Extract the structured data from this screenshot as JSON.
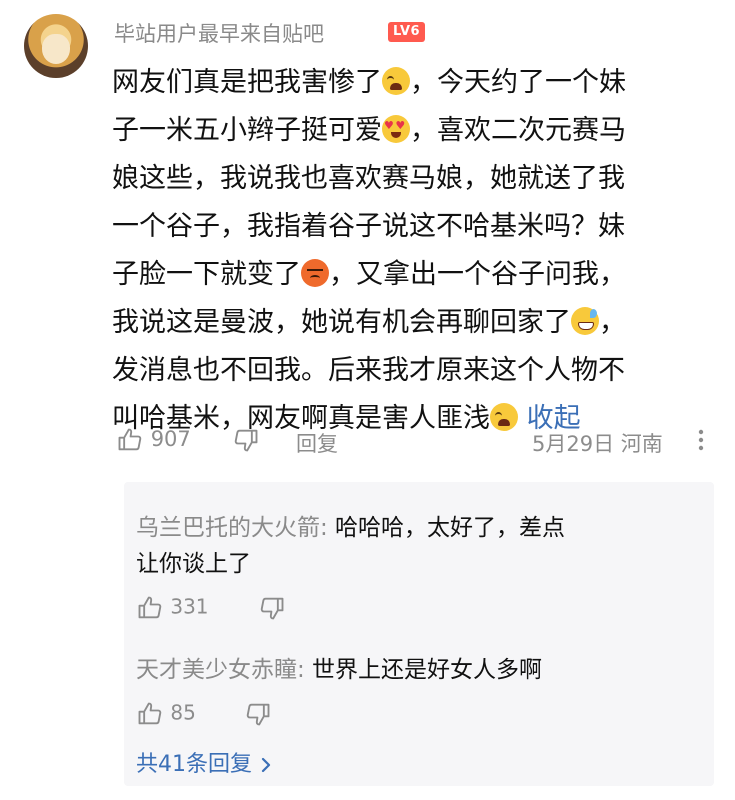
{
  "comment": {
    "username": "毕站用户最早来自贴吧",
    "level_badge": "LV6",
    "lines": [
      {
        "text": "网友们真是把我害惨了",
        "emoji": "crying-face",
        "tail": "，今天约了一个妹"
      },
      {
        "text": "子一米五小辫子挺可爱",
        "emoji": "heart-eyes-face",
        "tail": "，喜欢二次元赛马"
      },
      {
        "text": "娘这些，我说我也喜欢赛马娘，她就送了我",
        "emoji": "",
        "tail": ""
      },
      {
        "text": "一个谷子，我指着谷子说这不哈基米吗？妹",
        "emoji": "",
        "tail": ""
      },
      {
        "text": "子脸一下就变了",
        "emoji": "angry-face",
        "tail": "，又拿出一个谷子问我，"
      },
      {
        "text": "我说这是曼波，她说有机会再聊回家了",
        "emoji": "sweat-smile-face",
        "tail": "，"
      },
      {
        "text": "发消息也不回我。后来我才原来这个人物不",
        "emoji": "",
        "tail": ""
      },
      {
        "text": "叫哈基米，网友啊真是害人匪浅",
        "emoji": "crying-face",
        "tail": ""
      }
    ],
    "collapse_label": "收起",
    "like_count": "907",
    "reply_label": "回复",
    "date": "5月29日",
    "location": "河南"
  },
  "replies": [
    {
      "name": "乌兰巴托的大火箭:",
      "text_line1": " 哈哈哈，太好了，差点",
      "text_line2": "让你谈上了",
      "like_count": "331"
    },
    {
      "name": "天才美少女赤瞳:",
      "text_line1": " 世界上还是好女人多啊",
      "text_line2": "",
      "like_count": "85"
    }
  ],
  "total_replies_label": "共41条回复",
  "colors": {
    "link": "#3b6fb6",
    "muted": "#8a8a8a",
    "badge": "#ff5a4f",
    "reply_bg": "#f6f6f8"
  }
}
